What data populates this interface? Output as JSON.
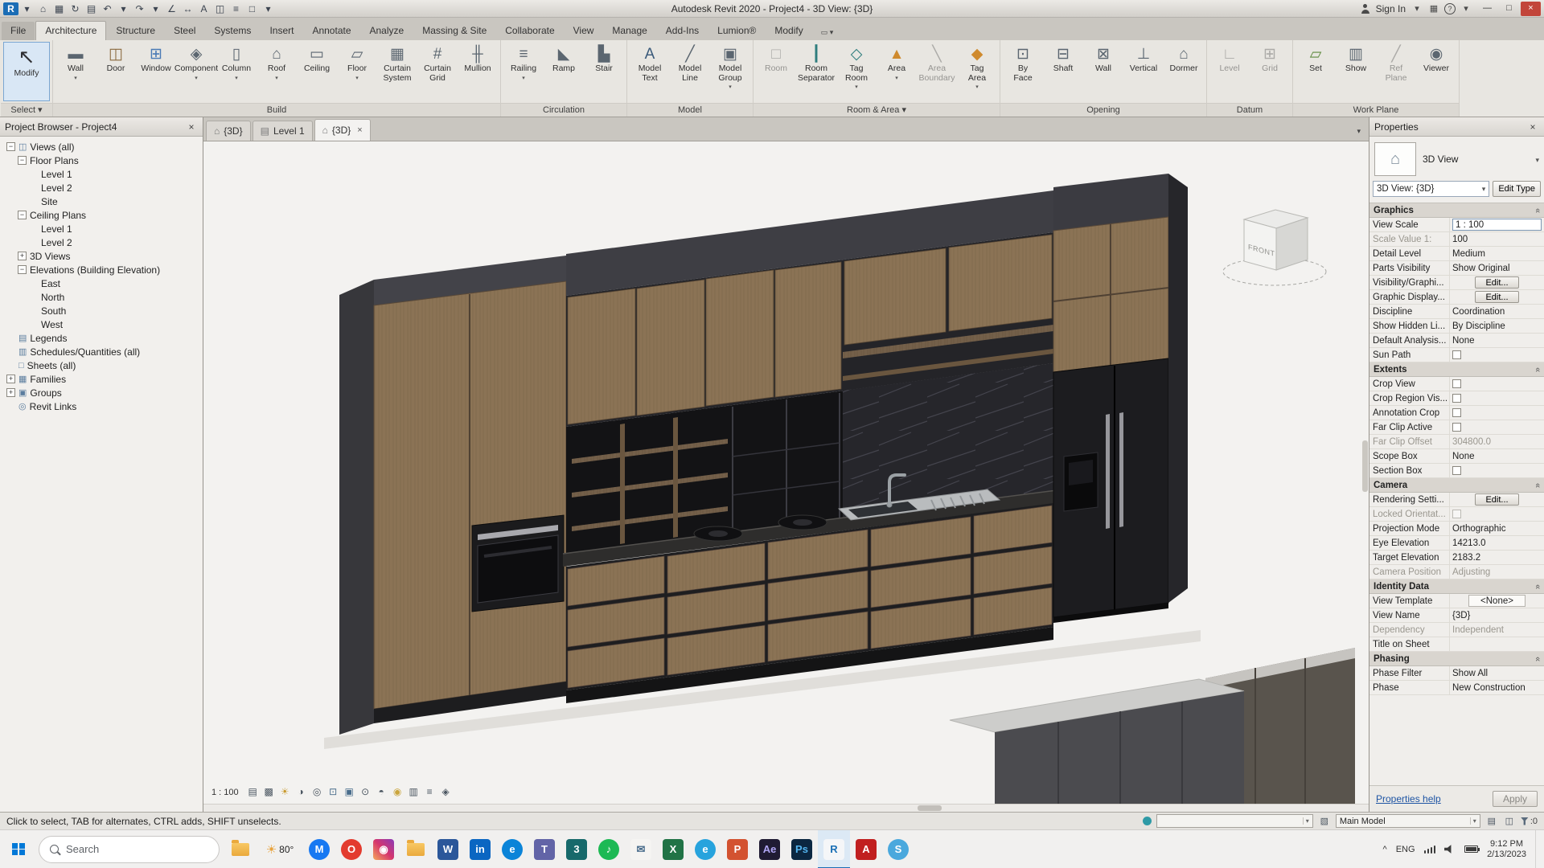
{
  "icons": {
    "dropdown_arrow": "▾",
    "collapse_chevron": "«",
    "tree_collapse": "−",
    "tree_expand": "+",
    "close": "×"
  },
  "title_bar": {
    "title": "Autodesk Revit 2020 - Project4 - 3D View: {3D}",
    "qat": [
      {
        "name": "revit-logo",
        "glyph": "R",
        "logo": true
      },
      {
        "name": "qat-menu-arrow-icon",
        "glyph": "▾"
      },
      {
        "name": "home-icon",
        "glyph": "⌂"
      },
      {
        "name": "save-icon",
        "glyph": "▦"
      },
      {
        "name": "sync-icon",
        "glyph": "↻"
      },
      {
        "name": "print-icon",
        "glyph": "▤"
      },
      {
        "name": "undo-icon",
        "glyph": "↶"
      },
      {
        "name": "undo-arrow-icon",
        "glyph": "▾"
      },
      {
        "name": "redo-icon",
        "glyph": "↷"
      },
      {
        "name": "redo-arrow-icon",
        "glyph": "▾"
      },
      {
        "name": "measure-icon",
        "glyph": "∠"
      },
      {
        "name": "aligned-dimension-icon",
        "glyph": "↔"
      },
      {
        "name": "text-icon",
        "glyph": "A"
      },
      {
        "name": "section-icon",
        "glyph": "◫"
      },
      {
        "name": "thin-lines-icon",
        "glyph": "≡"
      },
      {
        "name": "default-3d-view-icon",
        "glyph": "□"
      },
      {
        "name": "customize-qat-icon",
        "glyph": "▾"
      }
    ],
    "signin_label": "Sign In",
    "infocenter": [
      {
        "name": "store-icon",
        "glyph": "▦"
      },
      {
        "name": "help-icon",
        "glyph": "?",
        "round": true
      },
      {
        "name": "help-arrow-icon",
        "glyph": "▾"
      }
    ],
    "window_buttons": [
      {
        "name": "minimize-button",
        "glyph": "—"
      },
      {
        "name": "maximize-button",
        "glyph": "□"
      },
      {
        "name": "close-button",
        "glyph": "×",
        "close": true
      }
    ]
  },
  "ribbon": {
    "tabs": [
      {
        "label": "File",
        "file": true
      },
      {
        "label": "Architecture",
        "active": true
      },
      {
        "label": "Structure"
      },
      {
        "label": "Steel"
      },
      {
        "label": "Systems"
      },
      {
        "label": "Insert"
      },
      {
        "label": "Annotate"
      },
      {
        "label": "Analyze"
      },
      {
        "label": "Massing & Site"
      },
      {
        "label": "Collaborate"
      },
      {
        "label": "View"
      },
      {
        "label": "Manage"
      },
      {
        "label": "Add-Ins"
      },
      {
        "label": "Lumion®"
      },
      {
        "label": "Modify"
      }
    ],
    "toggle_glyph": "▭ ▾",
    "panels": [
      {
        "name": "Select",
        "arrow": true,
        "buttons": [
          {
            "label": "Modify",
            "glyph": "↖",
            "big": true,
            "active": true
          }
        ]
      },
      {
        "name": "Build",
        "buttons": [
          {
            "label": "Wall",
            "glyph": "▬",
            "arrow": true
          },
          {
            "label": "Door",
            "glyph": "◫",
            "color": "#8a6a3f"
          },
          {
            "label": "Window",
            "glyph": "⊞",
            "color": "#4a7ab5"
          },
          {
            "label": "Component",
            "glyph": "◈",
            "arrow": true
          },
          {
            "label": "Column",
            "glyph": "▯",
            "arrow": true
          },
          {
            "label": "Roof",
            "glyph": "⌂",
            "arrow": true
          },
          {
            "label": "Ceiling",
            "glyph": "▭"
          },
          {
            "label": "Floor",
            "glyph": "▱",
            "arrow": true
          },
          {
            "label": "Curtain\nSystem",
            "glyph": "▦"
          },
          {
            "label": "Curtain\nGrid",
            "glyph": "#"
          },
          {
            "label": "Mullion",
            "glyph": "╫"
          }
        ]
      },
      {
        "name": "Circulation",
        "buttons": [
          {
            "label": "Railing",
            "glyph": "≡",
            "arrow": true
          },
          {
            "label": "Ramp",
            "glyph": "◣"
          },
          {
            "label": "Stair",
            "glyph": "▙"
          }
        ]
      },
      {
        "name": "Model",
        "buttons": [
          {
            "label": "Model\nText",
            "glyph": "A",
            "color": "#3a5a7a"
          },
          {
            "label": "Model\nLine",
            "glyph": "╱"
          },
          {
            "label": "Model\nGroup",
            "glyph": "▣",
            "arrow": true
          }
        ]
      },
      {
        "name": "Room & Area",
        "arrow": true,
        "buttons": [
          {
            "label": "Room",
            "glyph": "□",
            "disabled": true
          },
          {
            "label": "Room\nSeparator",
            "glyph": "┃",
            "color": "#2e7d7d"
          },
          {
            "label": "Tag\nRoom",
            "glyph": "◇",
            "arrow": true,
            "color": "#2e7d7d"
          },
          {
            "label": "Area",
            "glyph": "▲",
            "arrow": true,
            "color": "#cf8a2d"
          },
          {
            "label": "Area\nBoundary",
            "glyph": "╲",
            "disabled": true
          },
          {
            "label": "Tag\nArea",
            "glyph": "◆",
            "arrow": true,
            "color": "#cf8a2d"
          }
        ]
      },
      {
        "name": "Opening",
        "buttons": [
          {
            "label": "By\nFace",
            "glyph": "⊡"
          },
          {
            "label": "Shaft",
            "glyph": "⊟"
          },
          {
            "label": "Wall",
            "glyph": "⊠"
          },
          {
            "label": "Vertical",
            "glyph": "⊥"
          },
          {
            "label": "Dormer",
            "glyph": "⌂"
          }
        ]
      },
      {
        "name": "Datum",
        "buttons": [
          {
            "label": "Level",
            "glyph": "∟",
            "disabled": true
          },
          {
            "label": "Grid",
            "glyph": "⊞",
            "disabled": true
          }
        ]
      },
      {
        "name": "Work Plane",
        "buttons": [
          {
            "label": "Set",
            "glyph": "▱",
            "color": "#5e8a3f"
          },
          {
            "label": "Show",
            "glyph": "▥"
          },
          {
            "label": "Ref\nPlane",
            "glyph": "╱",
            "disabled": true
          },
          {
            "label": "Viewer",
            "glyph": "◉"
          }
        ]
      }
    ]
  },
  "project_browser": {
    "title": "Project Browser - Project4",
    "tree": [
      {
        "label": "Views (all)",
        "level": 0,
        "expand": "minus",
        "glyph": "◫"
      },
      {
        "label": "Floor Plans",
        "level": 1,
        "expand": "minus"
      },
      {
        "label": "Level 1",
        "level": 2
      },
      {
        "label": "Level 2",
        "level": 2
      },
      {
        "label": "Site",
        "level": 2
      },
      {
        "label": "Ceiling Plans",
        "level": 1,
        "expand": "minus"
      },
      {
        "label": "Level 1",
        "level": 2
      },
      {
        "label": "Level 2",
        "level": 2
      },
      {
        "label": "3D Views",
        "level": 1,
        "expand": "plus"
      },
      {
        "label": "Elevations (Building Elevation)",
        "level": 1,
        "expand": "minus"
      },
      {
        "label": "East",
        "level": 2
      },
      {
        "label": "North",
        "level": 2
      },
      {
        "label": "South",
        "level": 2
      },
      {
        "label": "West",
        "level": 2
      },
      {
        "label": "Legends",
        "level": 0,
        "glyph": "▤"
      },
      {
        "label": "Schedules/Quantities (all)",
        "level": 0,
        "glyph": "▥"
      },
      {
        "label": "Sheets (all)",
        "level": 0,
        "glyph": "□"
      },
      {
        "label": "Families",
        "level": 0,
        "expand": "plus",
        "glyph": "▦"
      },
      {
        "label": "Groups",
        "level": 0,
        "expand": "plus",
        "glyph": "▣"
      },
      {
        "label": "Revit Links",
        "level": 0,
        "glyph": "◎"
      }
    ]
  },
  "view_tabs": [
    {
      "label": "{3D}",
      "glyph": "⌂"
    },
    {
      "label": "Level 1",
      "glyph": "▤"
    },
    {
      "label": "{3D}",
      "glyph": "⌂",
      "active": true,
      "closable": true
    }
  ],
  "viewcube": {
    "front_label": "FRONT"
  },
  "view_control_bar": {
    "scale": "1 : 100",
    "icons": [
      {
        "name": "detail-level-icon",
        "glyph": "▤"
      },
      {
        "name": "visual-style-icon",
        "glyph": "▩"
      },
      {
        "name": "sun-path-icon",
        "glyph": "☀",
        "color": "#c99a2e"
      },
      {
        "name": "shadows-icon",
        "glyph": "◑"
      },
      {
        "name": "rendering-dialog-icon",
        "glyph": "◎"
      },
      {
        "name": "crop-view-icon",
        "glyph": "⊡",
        "color": "#4a6d8c"
      },
      {
        "name": "show-crop-icon",
        "glyph": "▣",
        "color": "#4a6d8c"
      },
      {
        "name": "lock-3d-view-icon",
        "glyph": "⊙"
      },
      {
        "name": "temporary-hide-isolate-icon",
        "glyph": "◓"
      },
      {
        "name": "reveal-hidden-icon",
        "glyph": "◉",
        "color": "#caa53d"
      },
      {
        "name": "temporary-view-properties-icon",
        "glyph": "▥"
      },
      {
        "name": "analytical-model-icon",
        "glyph": "≡"
      },
      {
        "name": "displacement-sets-icon",
        "glyph": "◈"
      }
    ]
  },
  "properties": {
    "title": "Properties",
    "type_name": "3D View",
    "type_glyph": "⌂",
    "selector": "3D View: {3D}",
    "edit_type": "Edit Type",
    "help": "Properties help",
    "apply": "Apply",
    "sections": [
      {
        "header": "Graphics",
        "rows": [
          {
            "label": "View Scale",
            "value": "1 : 100",
            "style": "input"
          },
          {
            "label": "Scale Value   1:",
            "value": "100",
            "ldim": true
          },
          {
            "label": "Detail Level",
            "value": "Medium"
          },
          {
            "label": "Parts Visibility",
            "value": "Show Original"
          },
          {
            "label": "Visibility/Graphi...",
            "value": "Edit...",
            "style": "button"
          },
          {
            "label": "Graphic Display...",
            "value": "Edit...",
            "style": "button"
          },
          {
            "label": "Discipline",
            "value": "Coordination"
          },
          {
            "label": "Show Hidden Li...",
            "value": "By Discipline"
          },
          {
            "label": "Default Analysis...",
            "value": "None"
          },
          {
            "label": "Sun Path",
            "style": "checkbox"
          }
        ]
      },
      {
        "header": "Extents",
        "rows": [
          {
            "label": "Crop View",
            "style": "checkbox"
          },
          {
            "label": "Crop Region Vis...",
            "style": "checkbox"
          },
          {
            "label": "Annotation Crop",
            "style": "checkbox"
          },
          {
            "label": "Far Clip Active",
            "style": "checkbox"
          },
          {
            "label": "Far Clip Offset",
            "value": "304800.0",
            "ldim": true,
            "dim": true
          },
          {
            "label": "Scope Box",
            "value": "None"
          },
          {
            "label": "Section Box",
            "style": "checkbox"
          }
        ]
      },
      {
        "header": "Camera",
        "rows": [
          {
            "label": "Rendering Setti...",
            "value": "Edit...",
            "style": "button"
          },
          {
            "label": "Locked Orientat...",
            "style": "checkbox",
            "ldim": true
          },
          {
            "label": "Projection Mode",
            "value": "Orthographic"
          },
          {
            "label": "Eye Elevation",
            "value": "14213.0"
          },
          {
            "label": "Target Elevation",
            "value": "2183.2"
          },
          {
            "label": "Camera Position",
            "value": "Adjusting",
            "ldim": true,
            "dim": true
          }
        ]
      },
      {
        "header": "Identity Data",
        "rows": [
          {
            "label": "View Template",
            "value": "<None>",
            "style": "box"
          },
          {
            "label": "View Name",
            "value": "{3D}"
          },
          {
            "label": "Dependency",
            "value": "Independent",
            "ldim": true,
            "dim": true
          },
          {
            "label": "Title on Sheet",
            "value": ""
          }
        ]
      },
      {
        "header": "Phasing",
        "rows": [
          {
            "label": "Phase Filter",
            "value": "Show All"
          },
          {
            "label": "Phase",
            "value": "New Construction"
          }
        ]
      }
    ]
  },
  "status_bar": {
    "hint": "Click to select, TAB for alternates, CTRL adds, SHIFT unselects.",
    "workset_value": "",
    "design_option": "Main Model",
    "selection_count": ":0",
    "icons": [
      {
        "name": "editable-only-icon",
        "glyph": "▧"
      },
      {
        "name": "exclude-options-icon",
        "glyph": "▤"
      },
      {
        "name": "press-drag-icon",
        "glyph": "◫"
      }
    ]
  },
  "taskbar": {
    "search_placeholder": "Search",
    "apps": [
      {
        "name": "file-explorer",
        "kind": "folder"
      },
      {
        "name": "weather",
        "kind": "weather",
        "glyph": "☀",
        "temp": "80°"
      },
      {
        "name": "messenger",
        "kind": "circle",
        "glyph": "M",
        "bg": "#1778f2"
      },
      {
        "name": "opera",
        "kind": "circle",
        "glyph": "O",
        "bg": "#e33b2e"
      },
      {
        "name": "instagram",
        "kind": "tile",
        "glyph": "◉",
        "bg": "linear-gradient(45deg,#f5a75b,#d6366c,#8a3ab9)"
      },
      {
        "name": "folder-2",
        "kind": "folder"
      },
      {
        "name": "word",
        "kind": "tile",
        "glyph": "W",
        "bg": "#2b579a"
      },
      {
        "name": "linkedin",
        "kind": "tile",
        "glyph": "in",
        "bg": "#0a66c2"
      },
      {
        "name": "edge",
        "kind": "circle",
        "glyph": "e",
        "bg": "#0b84d8"
      },
      {
        "name": "teams",
        "kind": "tile",
        "glyph": "T",
        "bg": "#6264a7"
      },
      {
        "name": "3ds-max",
        "kind": "tile",
        "glyph": "3",
        "bg": "#17696b"
      },
      {
        "name": "spotify",
        "kind": "circle",
        "glyph": "♪",
        "bg": "#1db954"
      },
      {
        "name": "mail",
        "kind": "tile",
        "glyph": "✉",
        "bg": "#f5f4f2",
        "fg": "#4a6d8c"
      },
      {
        "name": "excel",
        "kind": "tile",
        "glyph": "X",
        "bg": "#217346"
      },
      {
        "name": "internet-explorer",
        "kind": "circle",
        "glyph": "e",
        "bg": "#27a3dd"
      },
      {
        "name": "powerpoint",
        "kind": "tile",
        "glyph": "P",
        "bg": "#d35230"
      },
      {
        "name": "after-effects",
        "kind": "tile",
        "glyph": "Ae",
        "bg": "#1f1b33",
        "fg": "#b0a6f5"
      },
      {
        "name": "photoshop",
        "kind": "tile",
        "glyph": "Ps",
        "bg": "#0b2741",
        "fg": "#53b5f0"
      },
      {
        "name": "revit",
        "kind": "tile",
        "glyph": "R",
        "bg": "#f5f6f8",
        "fg": "#1a6fb5",
        "active": true
      },
      {
        "name": "acrobat",
        "kind": "tile",
        "glyph": "A",
        "bg": "#c11f1f"
      },
      {
        "name": "safari",
        "kind": "circle",
        "glyph": "S",
        "bg": "#4aa8dd"
      }
    ],
    "tray": {
      "chevron": "^",
      "lang": "ENG",
      "time": "9:12 PM",
      "date": "2/13/2023"
    }
  }
}
